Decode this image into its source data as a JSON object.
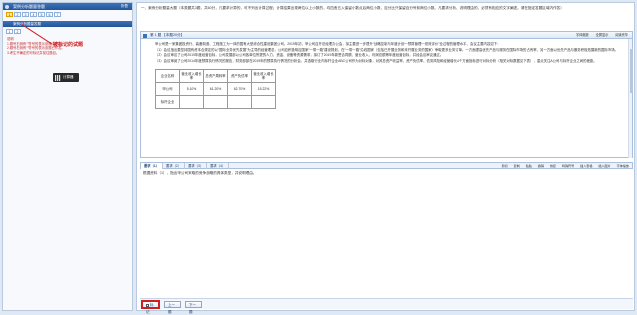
{
  "left_panel": {
    "header": "案例分析题量答题",
    "header_mini": "折叠",
    "questions_row1": [
      "1",
      "2",
      "3",
      "4",
      "5",
      "6",
      "7"
    ],
    "header2": "案例分析题量答题",
    "questions_row2": [
      "1",
      "2"
    ],
    "legend": [
      "说明",
      "1.题号右侧有“”符号的表示该题未作答。",
      "2.题号右侧有“”符号的表示该题已作答。",
      "3.考生不确定的可标记并前往题目。"
    ],
    "calculator_label": "计算器",
    "annotation": "被标记的试题"
  },
  "instructions": "一、案例分析题量大题（本类题共3题，共60分，凡要求计算的，可不列出计算过程；计算结果出现两位以上小数的，均四舍五入保留小数点后两位小数，百分比只保留百分号前两位小数。凡要求分析、说明理由的，必须有相应的文字阐述。请在指定答题区域内作答）",
  "material": {
    "title": "第 1 题 【本题20分】",
    "tools": [
      "字体缩放",
      "全屏显示",
      "阅读完毕"
    ],
    "paragraphs": [
      "甲公司是一家集团投资行、装备制造、工程施工为一体的国有大型综合性建设集团公司。2019年初，甲公司召开总经理办公会，拟主要进一步提升“战略控制与年度计划一预算管理一绩效评价”全过程的管理水平，会议主要内容如下：",
      "（1）会议指出要坚持国有资本合规定的以“国际业务优先发展”为主导的经营理念，公司应积极响应国家“一带一路”建设规划，在“一带一路”沿线国家（包括已开展业务和未开展业务的国家）争取更多业务订单。一方面提高优先产品与服务在国际市场的占有率，另一方面以优先产品与服务积极拓展新的国际市场。",
      "（2）会议审议了公司2019年度经营目标，公司发展部以公司各单位所提的人力、资金、设备等资源需求，拟订了2019年新签合同额、营业收入、利润总额等年度经营目标，并经会议审议通过。",
      "（3）会议审阅了公司2014年度预算执行情况的报告，财务部部在2019年的预算执行情况的分析会，并选取行业内标杆企业ABC公司作为对标对象，对其总资产收益率、资产负债率、债务风险和经营增长4个方面指标进行对标分析（相关对标数据见下表），重点关注A公司与标杆企业之间的差距。"
    ],
    "table": {
      "headers": [
        "企业名称",
        "营业收入增长率",
        "总资产周转率",
        "资产负债率",
        "营业收入增长率"
      ],
      "rows": [
        [
          "甲公司",
          "5.10%",
          "61.20%",
          "62.70%",
          "15.22%"
        ],
        [
          "标杆企业",
          "",
          "",
          "",
          ""
        ]
      ]
    }
  },
  "answer": {
    "tabs": [
      "要求（1）",
      "要求（2）",
      "要求（3）",
      "要求（4）"
    ],
    "tools": [
      "剪切",
      "复制",
      "粘贴",
      "撤销",
      "恢复",
      "特殊符号",
      "插入表格",
      "插入图片",
      "字体缩放"
    ],
    "question": "根据资料（1），指出甲公司采取的竞争战略的具体类型，并说明理由。"
  },
  "bottom": {
    "mark_label": "标记",
    "prev_label": "上一题",
    "next_label": "下一题"
  }
}
